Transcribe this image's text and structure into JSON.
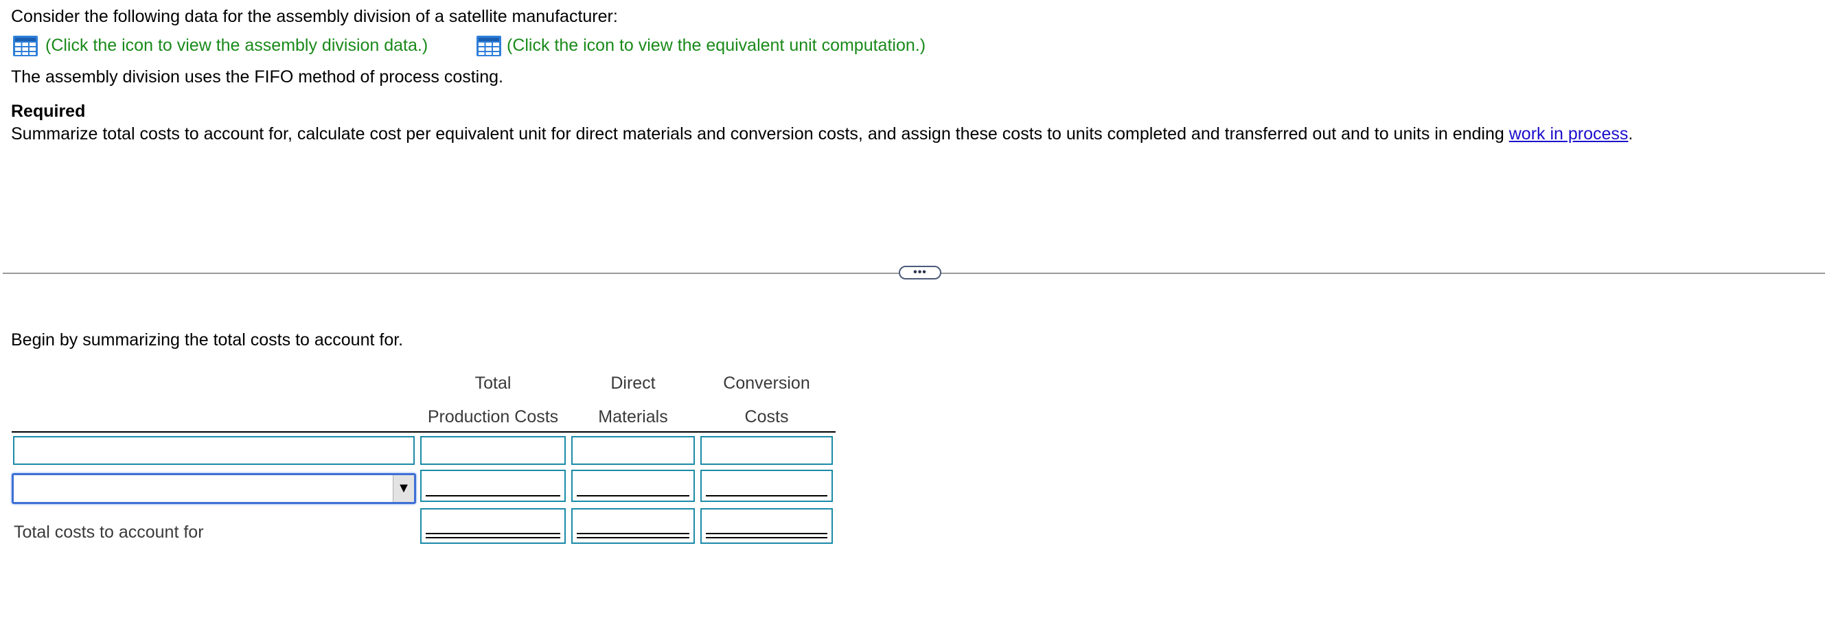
{
  "intro": {
    "line1": "Consider the following data for the assembly division of a satellite manufacturer:",
    "link1": "(Click the icon to view the assembly division data.)",
    "link2": "(Click the icon to view the equivalent unit computation.)",
    "line2": "The assembly division uses the FIFO method of process costing.",
    "required_heading": "Required",
    "required_text": "Summarize total costs to account for, calculate cost per equivalent unit for direct materials and conversion costs, and assign these costs to units completed and transferred out and to units in ending ",
    "required_link": "work in process",
    "required_end": "."
  },
  "divider": {
    "expand_label": "•••"
  },
  "section": {
    "prompt": "Begin by summarizing the total costs to account for."
  },
  "table": {
    "headers": {
      "total_line1": "Total",
      "total_line2": "Production Costs",
      "dm_line1": "Direct",
      "dm_line2": "Materials",
      "cc_line1": "Conversion",
      "cc_line2": "Costs"
    },
    "rows": [
      {
        "label_value": "",
        "total": "",
        "dm": "",
        "cc": ""
      },
      {
        "select_value": "",
        "total": "",
        "dm": "",
        "cc": ""
      }
    ],
    "total_label": "Total costs to account for",
    "totals": {
      "total": "",
      "dm": "",
      "cc": ""
    }
  },
  "colors": {
    "link_green": "#1a8a1a",
    "link_blue": "#1a0dcc",
    "field_border": "#1b8aa8",
    "select_border": "#3f6fd4",
    "icon_blue": "#2f7fd9"
  },
  "icons": {
    "data_icon": "table-grid-icon",
    "dropdown_arrow": "▼"
  }
}
